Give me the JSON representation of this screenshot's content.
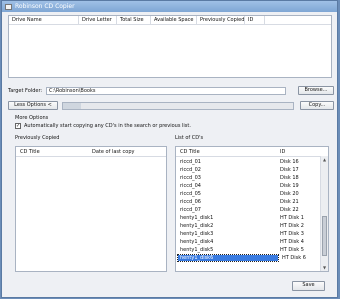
{
  "window": {
    "title": "Robinson CD Copier"
  },
  "drive_table": {
    "columns": [
      "Drive Name",
      "Drive Letter",
      "Total Size",
      "Available Space",
      "Previously Copied",
      "ID"
    ]
  },
  "target": {
    "label": "Target Folder:",
    "value": "C:\\Robinson\\Books",
    "browse_label": "Browse..."
  },
  "options_bar": {
    "less_options_label": "Less Options <",
    "copy_label": "Copy...",
    "progress_fraction": 0.08
  },
  "more_options": {
    "label": "More Options",
    "auto_copy_label": "Automatically start copying any CD's in the search or previous list.",
    "auto_copy_checked": true
  },
  "previously_copied": {
    "label": "Previously Copied",
    "columns": [
      "CD Title",
      "Date of last copy"
    ]
  },
  "cd_list": {
    "label": "List of CD's",
    "columns": [
      "CD Title",
      "ID"
    ],
    "rows": [
      {
        "title": "riccd_01",
        "id": "Disk 16"
      },
      {
        "title": "riccd_02",
        "id": "Disk 17"
      },
      {
        "title": "riccd_03",
        "id": "Disk 18"
      },
      {
        "title": "riccd_04",
        "id": "Disk 19"
      },
      {
        "title": "riccd_05",
        "id": "Disk 20"
      },
      {
        "title": "riccd_06",
        "id": "Disk 21"
      },
      {
        "title": "riccd_07",
        "id": "Disk 22"
      },
      {
        "title": "henty1_disk1",
        "id": "HT Disk 1"
      },
      {
        "title": "henty1_disk2",
        "id": "HT Disk 2"
      },
      {
        "title": "henty1_disk3",
        "id": "HT Disk 3"
      },
      {
        "title": "henty1_disk4",
        "id": "HT Disk 4"
      },
      {
        "title": "henty1_disk5",
        "id": "HT Disk 5"
      },
      {
        "title": "henty1_disk6",
        "id": "HT Disk 6"
      }
    ],
    "selected_index": 12
  },
  "save_label": "Save"
}
